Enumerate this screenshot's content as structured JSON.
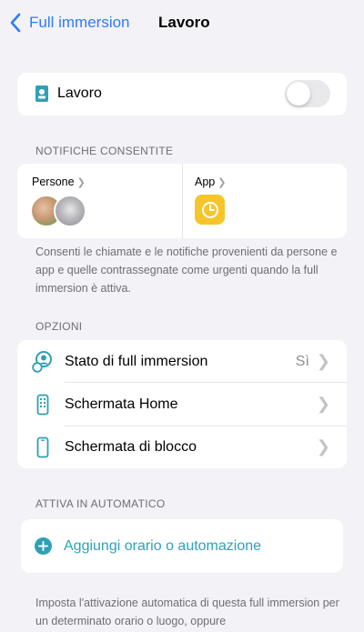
{
  "nav": {
    "back_label": "Full immersion",
    "title": "Lavoro"
  },
  "focus": {
    "name": "Lavoro",
    "enabled": false
  },
  "notifications": {
    "header": "NOTIFICHE CONSENTITE",
    "people_label": "Persone",
    "apps_label": "App",
    "footer": "Consenti le chiamate e le notifiche provenienti da persone e app e quelle contrassegnate come urgenti quando la full immersion è attiva."
  },
  "options": {
    "header": "OPZIONI",
    "items": [
      {
        "label": "Stato di full immersion",
        "value": "Sì",
        "icon": "focus-status-icon"
      },
      {
        "label": "Schermata Home",
        "value": "",
        "icon": "home-screen-icon"
      },
      {
        "label": "Schermata di blocco",
        "value": "",
        "icon": "lock-screen-icon"
      }
    ]
  },
  "automation": {
    "header": "ATTIVA IN AUTOMATICO",
    "add_label": "Aggiungi orario o automazione",
    "footer": "Imposta l'attivazione automatica di questa full immersion per un determinato orario o luogo, oppure"
  },
  "colors": {
    "accent_blue": "#2f7bf6",
    "teal": "#30a0b5",
    "app_yellow": "#f6c52a",
    "background": "#f2f2f7"
  }
}
